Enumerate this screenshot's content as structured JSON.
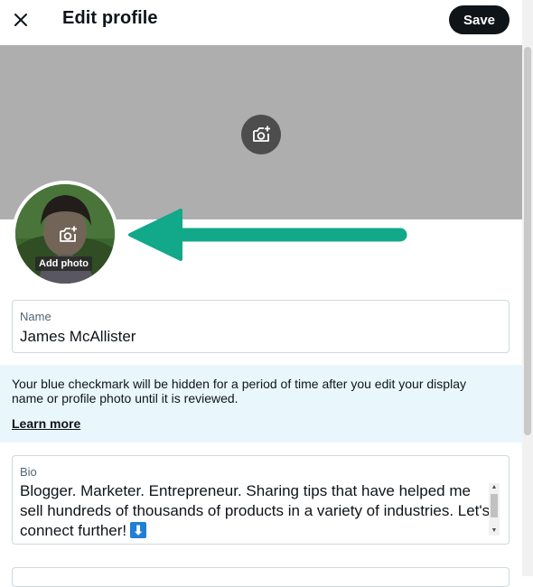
{
  "header": {
    "title": "Edit profile",
    "close_icon": "close-icon",
    "save_label": "Save"
  },
  "banner": {
    "camera_icon": "add-photo-camera-icon",
    "background_color": "#aeaeae"
  },
  "avatar": {
    "camera_icon": "add-photo-camera-icon",
    "add_photo_label": "Add photo"
  },
  "annotation": {
    "arrow_color": "#12a88a",
    "arrow_icon": "arrow-left-icon"
  },
  "name_field": {
    "label": "Name",
    "value": "James McAllister"
  },
  "verification_notice": {
    "text": "Your blue checkmark will be hidden for a period of time after you edit your display name or profile photo until it is reviewed.",
    "link_label": "Learn more",
    "background_color": "#e9f7fd"
  },
  "bio_field": {
    "label": "Bio",
    "value": "Blogger. Marketer. Entrepreneur. Sharing tips that have helped me sell hundreds of thousands of products in a variety of industries. Let's connect further!",
    "emoji_icon": "down-arrow-emoji-icon",
    "emoji_glyph": "⬇"
  },
  "colors": {
    "save_button": "#0f1419",
    "border": "#cfd9de",
    "muted_text": "#536471"
  }
}
